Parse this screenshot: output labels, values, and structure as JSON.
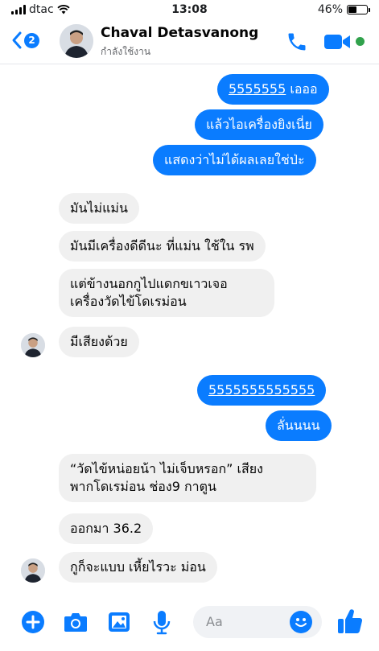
{
  "status_bar": {
    "carrier": "dtac",
    "time": "13:08",
    "battery": "46%",
    "battery_level": 0.46
  },
  "header": {
    "back_count": "2",
    "contact_name": "Chaval Detasvanong",
    "contact_status": "กำลังใช้งาน",
    "icons": [
      "back-chevron-icon",
      "phone-icon",
      "video-camera-icon",
      "online-indicator"
    ]
  },
  "messages": {
    "m1_link": "5555555",
    "m1_rest": " เอออ",
    "m2": "แล้วไอเครื่องยิงเนี่ย",
    "m3": "แสดงว่าไม่ได้ผลเลยใช่ป่ะ",
    "m4": "มันไม่แม่น",
    "m5": "มันมีเครื่องดีดีนะ ที่แม่น ใช้ใน รพ",
    "m6_line1": "แต่ข้างนอกกูไปแดกขเาวเจอ",
    "m6_line2": "เครื่องวัดไข้โดเรม่อน",
    "m7": "มีเสียงด้วย",
    "m8_link": "5555555555555",
    "m9": "ลั่นนนน",
    "m10_line1": "“วัดไข้หน่อยน้า ไม่เจ็บหรอก” เสียง",
    "m10_line2": "พากโดเรม่อน ช่อง9 กาตูน",
    "m11": "ออกมา 36.2",
    "m12": "กูก็จะแบบ เหี้ยไรวะ ม่อน"
  },
  "composer": {
    "placeholder": "Aa",
    "icons": [
      "plus-icon",
      "camera-icon",
      "gallery-icon",
      "microphone-icon",
      "emoji-icon",
      "thumbs-up-icon"
    ]
  },
  "colors": {
    "accent": "#0a7cff",
    "incoming_bubble": "#f0f0f0",
    "online": "#31a24c"
  }
}
